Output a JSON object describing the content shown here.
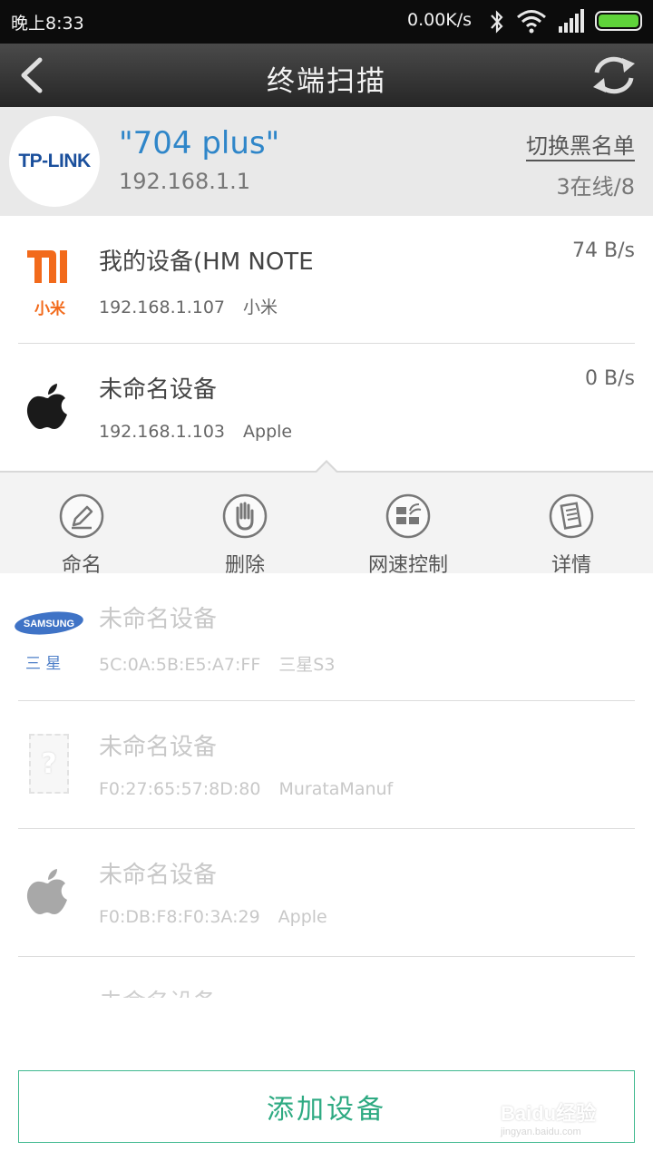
{
  "status_bar": {
    "time": "晚上8:33",
    "net_speed": "0.00K/s"
  },
  "header": {
    "title": "终端扫描"
  },
  "router": {
    "logo_text": "TP-LINK",
    "name": "\"704 plus\"",
    "ip": "192.168.1.1",
    "blacklist_label": "切换黑名单",
    "online_count": "3在线/8"
  },
  "devices": [
    {
      "name": "我的设备(HM NOTE",
      "ip": "192.168.1.107",
      "vendor": "小米",
      "speed": "74 B/s",
      "brand_icon": "xiaomi-logo-icon",
      "brand_label": "小米"
    },
    {
      "name": "未命名设备",
      "ip": "192.168.1.103",
      "vendor": "Apple",
      "speed": "0 B/s",
      "brand_icon": "apple-logo-icon"
    },
    {
      "name": "未命名设备",
      "ip": "5C:0A:5B:E5:A7:FF",
      "vendor": "三星S3",
      "brand_icon": "samsung-logo-icon",
      "brand_label": "三 星",
      "brand_logo_text": "SAMSUNG"
    },
    {
      "name": "未命名设备",
      "ip": "F0:27:65:57:8D:80",
      "vendor": "MurataManuf",
      "brand_icon": "unknown-device-icon",
      "brand_label": "?"
    },
    {
      "name": "未命名设备",
      "ip": "F0:DB:F8:F0:3A:29",
      "vendor": "Apple",
      "brand_icon": "apple-logo-icon"
    },
    {
      "name": "未命名设备"
    }
  ],
  "actions": [
    {
      "label": "命名",
      "icon": "pencil-icon"
    },
    {
      "label": "删除",
      "icon": "hand-stop-icon"
    },
    {
      "label": "网速控制",
      "icon": "speed-control-icon"
    },
    {
      "label": "详情",
      "icon": "details-icon"
    }
  ],
  "add_device_label": "添加设备",
  "watermark": {
    "text": "Baidu经验",
    "sub": "jingyan.baidu.com"
  },
  "colors": {
    "accent_green": "#2eaa82",
    "router_blue": "#2f86c9",
    "xiaomi_orange": "#f26a1b",
    "tplink_blue": "#1a4f9c"
  }
}
